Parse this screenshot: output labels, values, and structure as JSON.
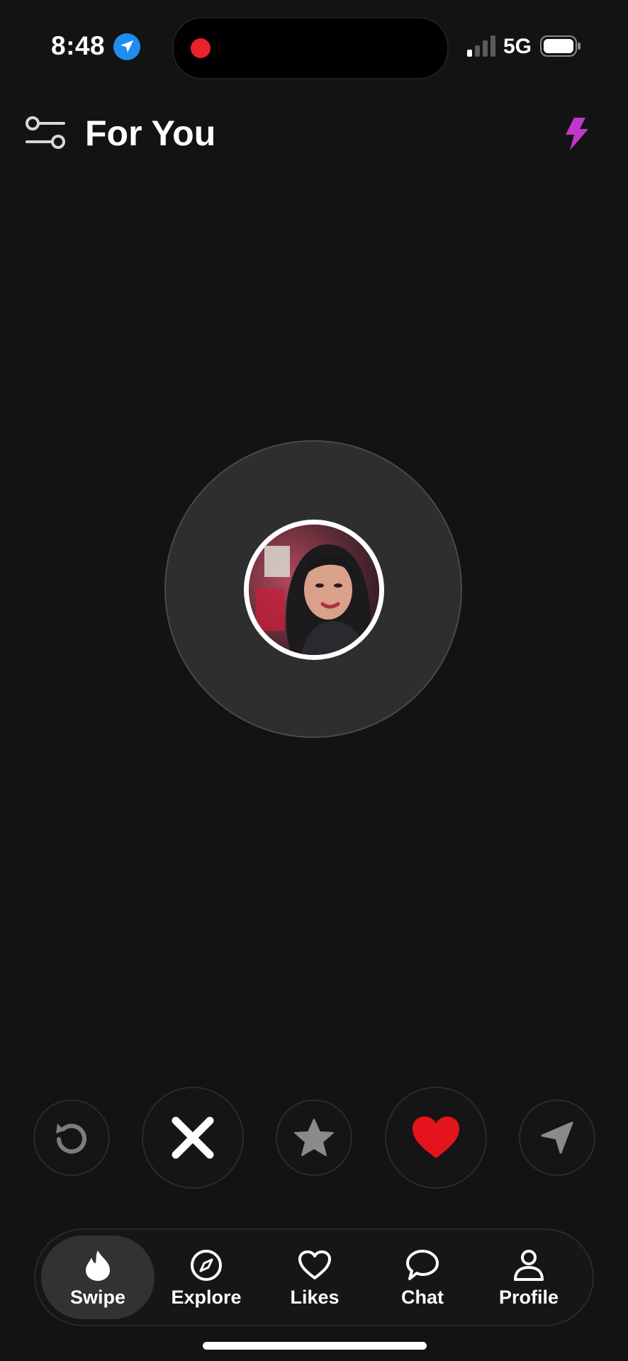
{
  "status_bar": {
    "time": "8:48",
    "network": "5G",
    "icons": [
      "location-arrow-icon",
      "signal-bars-icon",
      "battery-icon"
    ],
    "recording_color": "#e8232b"
  },
  "header": {
    "title": "For You",
    "left_icon": "filter-sliders-icon",
    "right_icon": "lightning-bolt-icon",
    "accent_color": "#c237c9"
  },
  "center": {
    "avatar_alt": "profile photo"
  },
  "actions": [
    {
      "name": "rewind",
      "icon": "undo-arrow-icon"
    },
    {
      "name": "nope",
      "icon": "close-x-icon"
    },
    {
      "name": "super-like",
      "icon": "star-icon"
    },
    {
      "name": "like",
      "icon": "heart-icon",
      "color": "#e5131b"
    },
    {
      "name": "send",
      "icon": "paper-plane-icon"
    }
  ],
  "bottom_nav": {
    "items": [
      {
        "label": "Swipe",
        "icon": "flame-icon",
        "active": true
      },
      {
        "label": "Explore",
        "icon": "compass-icon",
        "active": false
      },
      {
        "label": "Likes",
        "icon": "heart-outline-icon",
        "active": false
      },
      {
        "label": "Chat",
        "icon": "chat-bubble-icon",
        "active": false
      },
      {
        "label": "Profile",
        "icon": "person-icon",
        "active": false
      }
    ]
  }
}
